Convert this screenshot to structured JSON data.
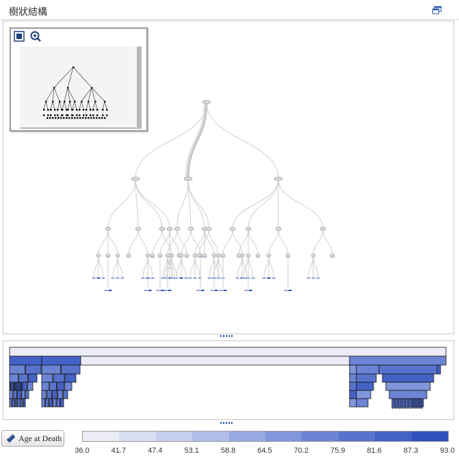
{
  "header": {
    "title": "樹狀結構"
  },
  "legend": {
    "button_label": "Age at Death",
    "ticks": [
      "36.0",
      "41.7",
      "47.4",
      "53.1",
      "58.8",
      "64.5",
      "70.2",
      "75.9",
      "81.6",
      "87.3",
      "93.0"
    ],
    "colors": [
      "#ececf7",
      "#d9dff3",
      "#c6cfee",
      "#afbde8",
      "#97a9e1",
      "#8197db",
      "#6c84d4",
      "#5873cc",
      "#4462c5",
      "#2f50bd"
    ]
  },
  "icons": {
    "window": "restore-window-icon",
    "overview_fit": "fit-square-icon",
    "overview_zoom": "zoom-icon",
    "legend": "ruler-icon"
  }
}
